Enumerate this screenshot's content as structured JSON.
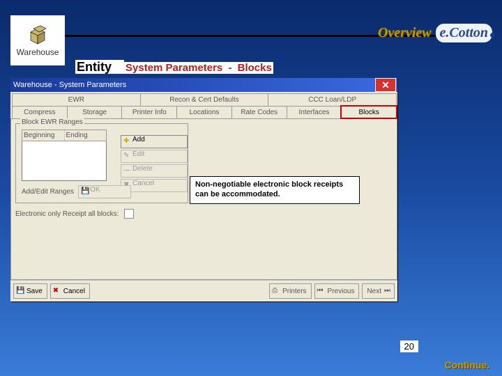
{
  "header": {
    "app_label": "Warehouse",
    "overview": "Overview",
    "brand": "e.Cotton"
  },
  "breadcrumb": {
    "entity": "Entity",
    "dash": " - ",
    "system_parameters": "System Parameters",
    "dash2": " - ",
    "blocks": "Blocks"
  },
  "window": {
    "title": "Warehouse - System Parameters",
    "tabs_row1": [
      "EWR",
      "Recon & Cert Defaults",
      "CCC Loan/LDP"
    ],
    "tabs_row2": [
      "Compress",
      "Storage",
      "Printer Info",
      "Locations",
      "Rate Codes",
      "Interfaces",
      "Blocks"
    ],
    "group_label": "Block EWR Ranges",
    "cols": {
      "beginning": "Beginning",
      "ending": "Ending"
    },
    "buttons": {
      "add": "Add",
      "edit": "Edit",
      "delete": "Delete",
      "cancel": "Cancel",
      "addedit_label": "Add/Edit Ranges",
      "ok": "OK"
    },
    "checkbox_label": "Electronic only Receipt all blocks:",
    "bottom": {
      "save": "Save",
      "cancel": "Cancel",
      "printers": "Printers",
      "previous": "Previous",
      "next": "Next"
    }
  },
  "callout": "Non-negotiable electronic block receipts can be accommodated.",
  "page_number": "20",
  "continue": "Continue."
}
